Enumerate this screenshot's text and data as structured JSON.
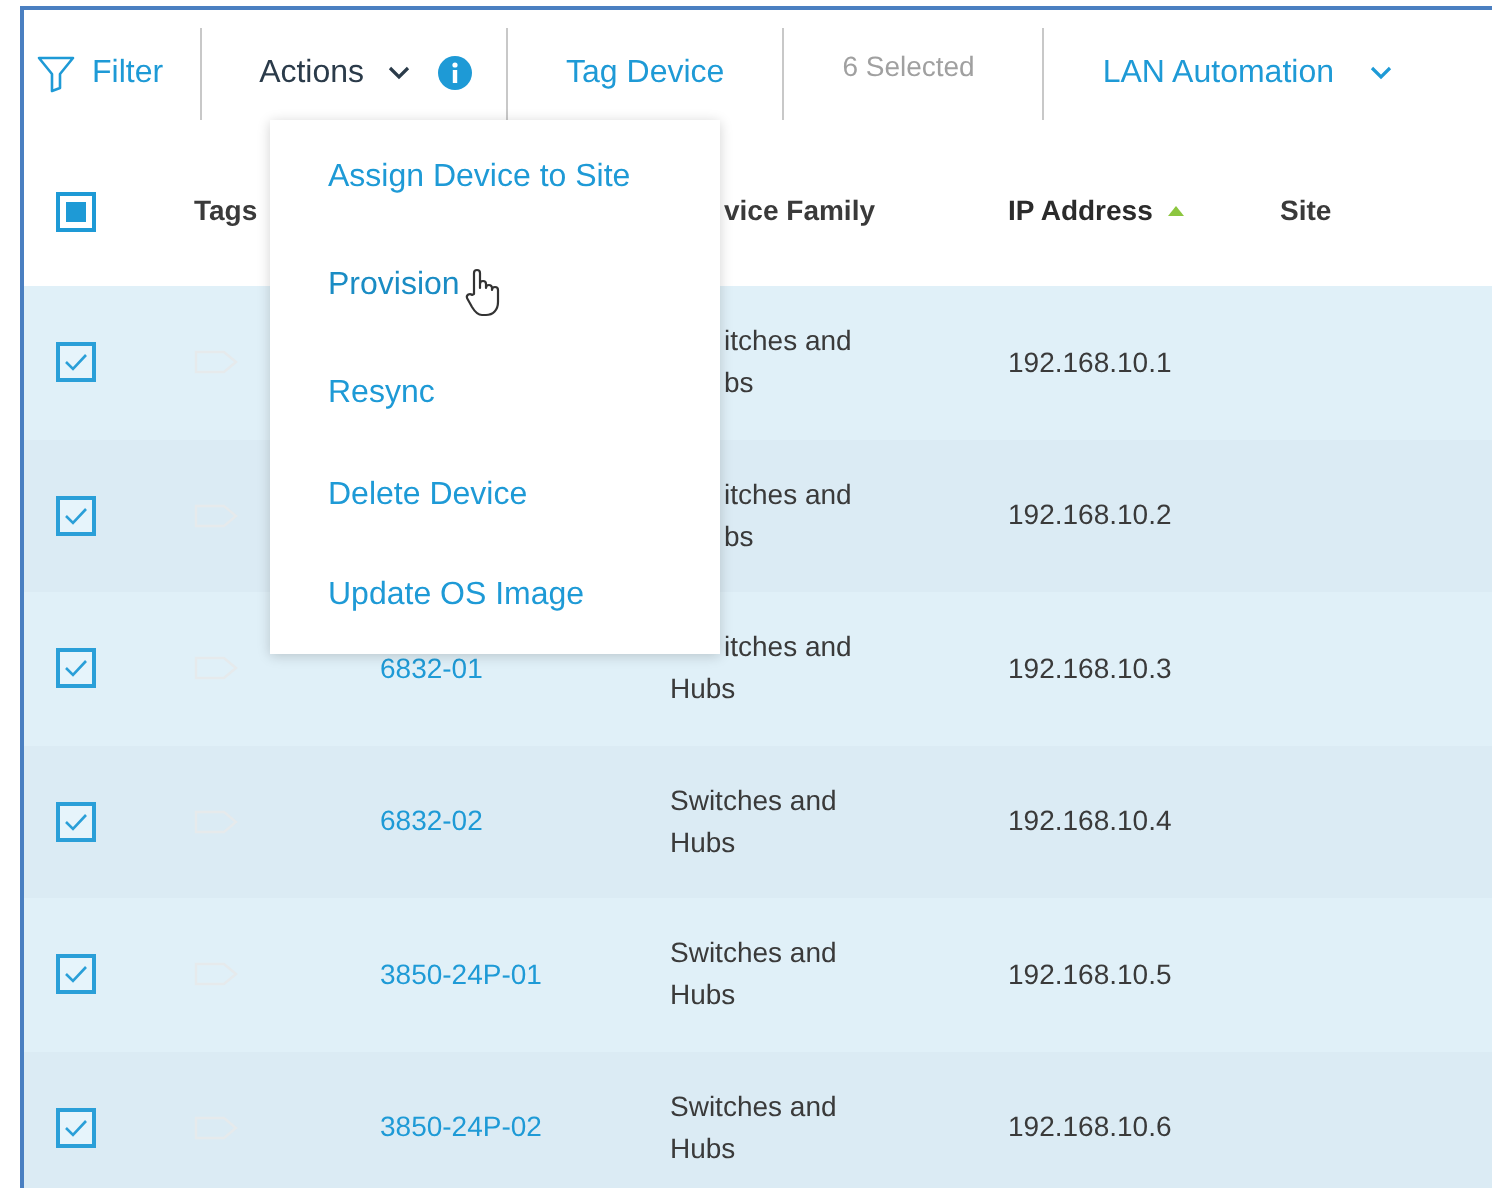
{
  "toolbar": {
    "filter": "Filter",
    "actions": "Actions",
    "tag_device": "Tag Device",
    "selected_count": "6 Selected",
    "lan_automation": "LAN Automation"
  },
  "actions_menu": {
    "items": [
      {
        "label": "Assign Device to Site",
        "hovered": false
      },
      {
        "label": "Provision",
        "hovered": true
      },
      {
        "label": "Resync",
        "hovered": false
      },
      {
        "label": "Delete Device",
        "hovered": false
      },
      {
        "label": "Update OS Image",
        "hovered": false
      }
    ]
  },
  "table": {
    "select_all": {
      "partial": true
    },
    "columns": [
      {
        "label": "Tags",
        "sorted_ascending": false
      },
      {
        "label": "vice Family",
        "sorted_ascending": false
      },
      {
        "label": "IP Address",
        "sorted_ascending": true
      },
      {
        "label": "Site",
        "sorted_ascending": false
      }
    ],
    "rows": [
      {
        "checked": true,
        "family": [
          "itches and",
          "bs"
        ],
        "ip": "192.168.10.1"
      },
      {
        "checked": true,
        "family": [
          "itches and",
          "bs"
        ],
        "ip": "192.168.10.2"
      },
      {
        "checked": true,
        "name": "6832-01",
        "family": [
          "itches and",
          "Hubs"
        ],
        "ip": "192.168.10.3"
      },
      {
        "checked": true,
        "name": "6832-02",
        "family": [
          "Switches and",
          "Hubs"
        ],
        "ip": "192.168.10.4"
      },
      {
        "checked": true,
        "name": "3850-24P-01",
        "family": [
          "Switches and",
          "Hubs"
        ],
        "ip": "192.168.10.5"
      },
      {
        "checked": true,
        "name": "3850-24P-02",
        "family": [
          "Switches and",
          "Hubs"
        ],
        "ip": "192.168.10.6"
      }
    ]
  }
}
